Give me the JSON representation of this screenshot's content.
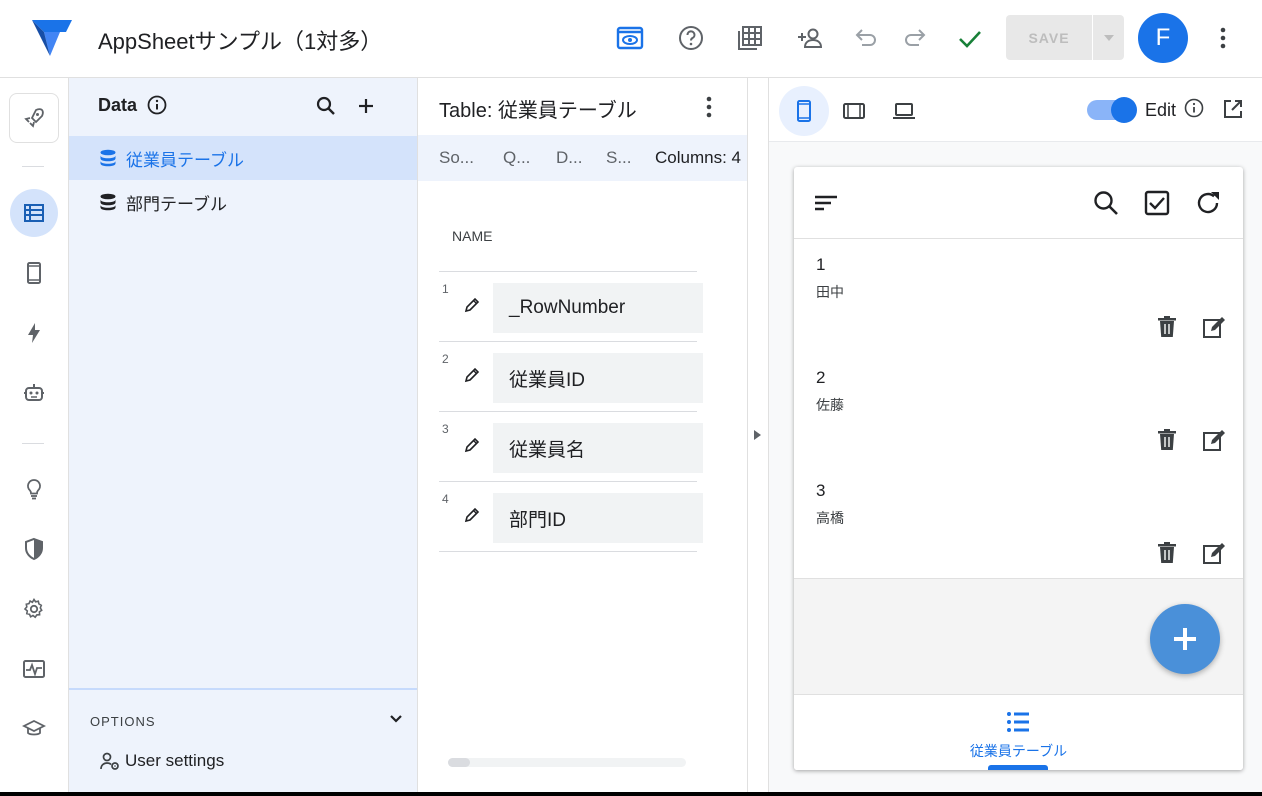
{
  "header": {
    "app_title": "AppSheetサンプル（1対多）",
    "save_label": "SAVE",
    "avatar_initial": "F"
  },
  "data_panel": {
    "title": "Data",
    "tables": [
      {
        "label": "従業員テーブル"
      },
      {
        "label": "部門テーブル"
      }
    ],
    "options_label": "OPTIONS",
    "user_settings_label": "User settings"
  },
  "table_panel": {
    "title": "Table: 従業員テーブル",
    "tabs": [
      "So...",
      "Q...",
      "D...",
      "S...",
      "Columns: 4"
    ],
    "column_header": "NAME",
    "rows": [
      {
        "num": "1",
        "name": "_RowNumber"
      },
      {
        "num": "2",
        "name": "従業員ID"
      },
      {
        "num": "3",
        "name": "従業員名"
      },
      {
        "num": "4",
        "name": "部門ID"
      }
    ]
  },
  "preview": {
    "edit_label": "Edit",
    "records": [
      {
        "id": "1",
        "name": "田中"
      },
      {
        "id": "2",
        "name": "佐藤"
      },
      {
        "id": "3",
        "name": "高橋"
      }
    ],
    "nav_label": "従業員テーブル"
  },
  "colors": {
    "accent": "#1a73e8",
    "selected_bg": "#d4e3fb",
    "panel_bg": "#eef3fc",
    "check_green": "#188038",
    "fab": "#4a90d9"
  }
}
